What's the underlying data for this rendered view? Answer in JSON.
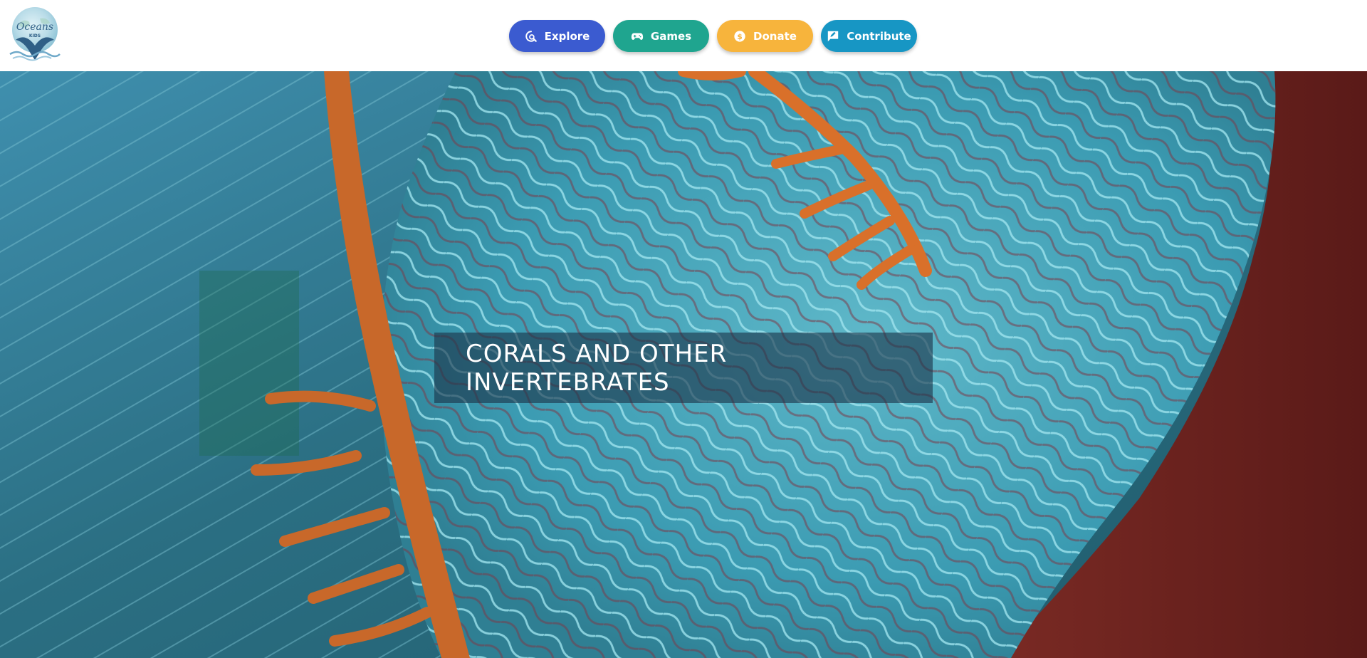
{
  "logo": {
    "brand_name": "Oceans",
    "brand_sub": "KIDS",
    "icon": "whale-tail-globe-logo"
  },
  "nav": {
    "buttons": [
      {
        "label": "Explore",
        "icon": "explore-search-icon",
        "color": "#3b5bd0"
      },
      {
        "label": "Games",
        "icon": "gamepad-icon",
        "color": "#1fa58f"
      },
      {
        "label": "Donate",
        "icon": "dollar-coin-icon",
        "color": "#f7b43c"
      },
      {
        "label": "Contribute",
        "icon": "chat-edit-icon",
        "color": "#1796c4"
      }
    ]
  },
  "hero": {
    "title": "CORALS AND OTHER INVERTEBRATES",
    "image": "brain-coral-underwater-photo"
  }
}
